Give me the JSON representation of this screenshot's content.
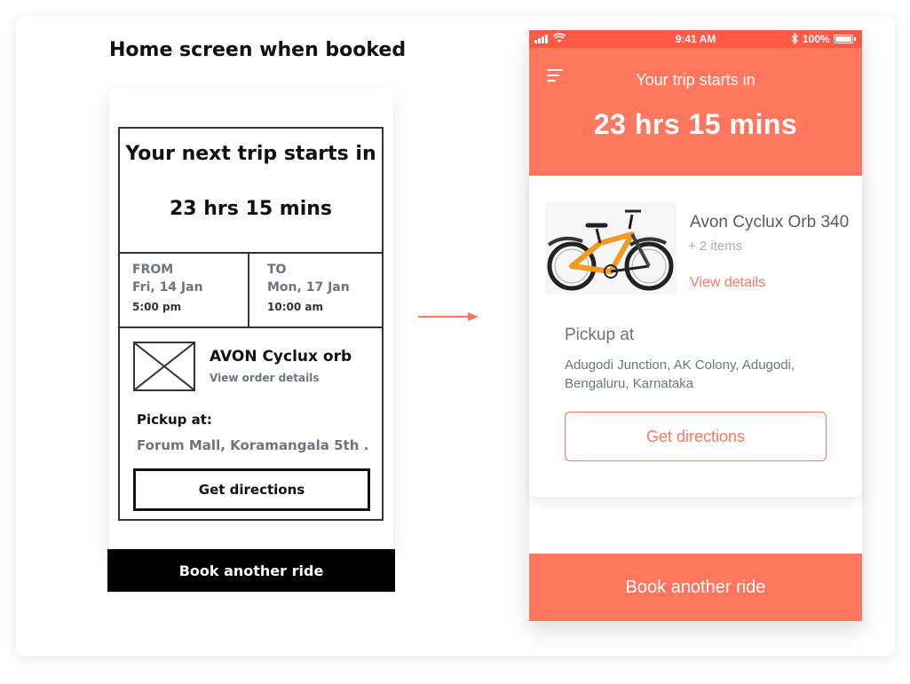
{
  "wireframe": {
    "title": "Home screen when booked",
    "trip_label": "Your next trip starts in",
    "trip_time": "23 hrs 15 mins",
    "from": {
      "label": "FROM",
      "date": "Fri, 14 Jan",
      "time": "5:00 pm"
    },
    "to": {
      "label": "TO",
      "date": "Mon, 17 Jan",
      "time": "10:00 am"
    },
    "product_name": "AVON Cyclux orb",
    "view_order": "View order details",
    "pickup_label": "Pickup at:",
    "pickup_address": "Forum Mall, Koramangala 5th ...",
    "directions_label": "Get directions",
    "book_label": "Book another ride",
    "image_placeholder_icon": "image-placeholder-icon"
  },
  "hifi": {
    "status_bar": {
      "time": "9:41 AM",
      "battery": "100%",
      "color": "#ff5a45"
    },
    "accent_color": "#ff765f",
    "trip_label": "Your trip starts in",
    "trip_time": "23 hrs 15 mins",
    "product_name": "Avon Cyclux Orb 340",
    "items": "+ 2 items",
    "view_details": "View details",
    "pickup_label": "Pickup at",
    "pickup_address": "Adugodi Junction, AK Colony, Adugodi, Bengaluru, Karnataka",
    "directions_label": "Get directions",
    "book_label": "Book another ride",
    "menu_icon": "hamburger-menu-icon",
    "product_image": "bicycle-image"
  }
}
